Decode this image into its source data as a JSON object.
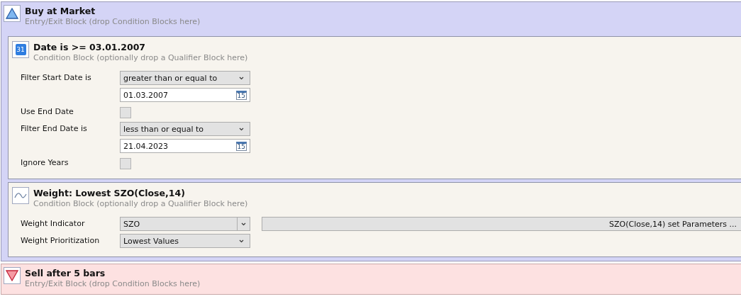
{
  "blocks": [
    {
      "kind": "entry",
      "title": "Buy at Market",
      "subtitle": "Entry/Exit Block (drop Condition Blocks here)",
      "conditions": [
        {
          "kind": "date",
          "icon_text": "31",
          "title": "Date is >= 03.01.2007",
          "subtitle": "Condition Block (optionally drop a Qualifier Block here)",
          "rows": [
            {
              "kind": "select",
              "label": "Filter Start Date is",
              "value": "greater than or equal to"
            },
            {
              "kind": "date",
              "value": "01.03.2007",
              "icon_text": "15"
            },
            {
              "kind": "checkbox",
              "label": "Use End Date",
              "checked": false
            },
            {
              "kind": "select",
              "label": "Filter End Date is",
              "value": "less than or equal to"
            },
            {
              "kind": "date",
              "value": "21.04.2023",
              "icon_text": "15"
            },
            {
              "kind": "checkbox",
              "label": "Ignore Years",
              "checked": false
            }
          ]
        },
        {
          "kind": "weight",
          "title": "Weight: Lowest SZO(Close,14)",
          "subtitle": "Condition Block (optionally drop a Qualifier Block here)",
          "rows": [
            {
              "kind": "split",
              "label": "Weight Indicator",
              "value": "SZO",
              "action": "SZO(Close,14) set Parameters ..."
            },
            {
              "kind": "select",
              "label": "Weight Prioritization",
              "value": "Lowest Values"
            }
          ]
        }
      ]
    },
    {
      "kind": "exit",
      "title": "Sell after 5 bars",
      "subtitle": "Entry/Exit Block (drop Condition Blocks here)"
    }
  ]
}
